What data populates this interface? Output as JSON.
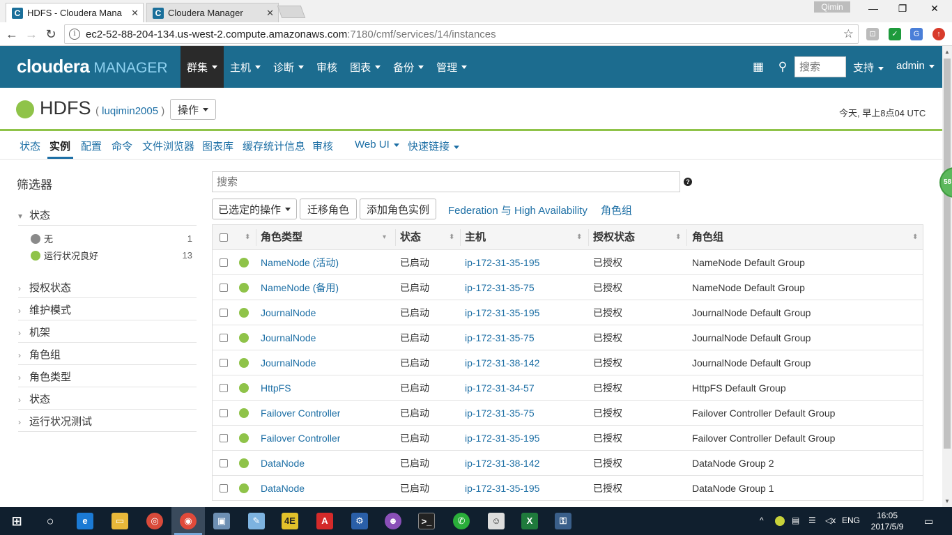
{
  "browser": {
    "tabs": [
      {
        "title": "HDFS - Cloudera Mana",
        "favicon": "C",
        "active": true
      },
      {
        "title": "Cloudera Manager",
        "favicon": "C",
        "active": false
      }
    ],
    "profile": "Qimin",
    "url_host": "ec2-52-88-204-134.us-west-2.compute.amazonaws.com",
    "url_path": ":7180/cmf/services/14/instances",
    "icons": [
      "back-icon",
      "forward-icon",
      "reload-icon",
      "star-icon"
    ]
  },
  "cm_header": {
    "logo_brand": "cloudera",
    "logo_product": "MANAGER",
    "nav": [
      "群集",
      "主机",
      "诊断",
      "审核",
      "图表",
      "备份",
      "管理"
    ],
    "nav_has_caret": [
      true,
      true,
      true,
      false,
      true,
      true,
      true
    ],
    "search_placeholder": "搜索",
    "support": "支持",
    "user": "admin"
  },
  "service": {
    "name": "HDFS",
    "cluster_prefix": "(",
    "cluster": "luqimin2005",
    "cluster_suffix": ")",
    "actions_label": "操作",
    "status_color": "#8fc349",
    "timestamp": "今天, 早上8点04 UTC"
  },
  "subtabs": [
    "状态",
    "实例",
    "配置",
    "命令",
    "文件浏览器",
    "图表库",
    "缓存统计信息",
    "审核",
    "Web UI",
    "快速链接"
  ],
  "subtabs_active": "实例",
  "filters": {
    "title": "筛选器",
    "status_section": "状态",
    "status_items": [
      {
        "label": "无",
        "count": "1",
        "color": "#8a8a8a"
      },
      {
        "label": "运行状况良好",
        "count": "13",
        "color": "#8fc349"
      }
    ],
    "sections": [
      "授权状态",
      "维护模式",
      "机架",
      "角色组",
      "角色类型",
      "状态",
      "运行状况测试"
    ]
  },
  "toolbar": {
    "search_placeholder": "搜索",
    "selected_actions": "已选定的操作",
    "migrate_roles": "迁移角色",
    "add_role_instances": "添加角色实例",
    "federation_link": "Federation 与 High Availability",
    "role_groups_link": "角色组",
    "help": "?"
  },
  "table": {
    "headers": [
      "角色类型",
      "状态",
      "主机",
      "授权状态",
      "角色组"
    ],
    "rows": [
      {
        "role": "NameNode (活动)",
        "state": "已启动",
        "host": "ip-172-31-35-195",
        "commission": "已授权",
        "group": "NameNode Default Group"
      },
      {
        "role": "NameNode (备用)",
        "state": "已启动",
        "host": "ip-172-31-35-75",
        "commission": "已授权",
        "group": "NameNode Default Group"
      },
      {
        "role": "JournalNode",
        "state": "已启动",
        "host": "ip-172-31-35-195",
        "commission": "已授权",
        "group": "JournalNode Default Group"
      },
      {
        "role": "JournalNode",
        "state": "已启动",
        "host": "ip-172-31-35-75",
        "commission": "已授权",
        "group": "JournalNode Default Group"
      },
      {
        "role": "JournalNode",
        "state": "已启动",
        "host": "ip-172-31-38-142",
        "commission": "已授权",
        "group": "JournalNode Default Group"
      },
      {
        "role": "HttpFS",
        "state": "已启动",
        "host": "ip-172-31-34-57",
        "commission": "已授权",
        "group": "HttpFS Default Group"
      },
      {
        "role": "Failover Controller",
        "state": "已启动",
        "host": "ip-172-31-35-75",
        "commission": "已授权",
        "group": "Failover Controller Default Group"
      },
      {
        "role": "Failover Controller",
        "state": "已启动",
        "host": "ip-172-31-35-195",
        "commission": "已授权",
        "group": "Failover Controller Default Group"
      },
      {
        "role": "DataNode",
        "state": "已启动",
        "host": "ip-172-31-38-142",
        "commission": "已授权",
        "group": "DataNode Group 2"
      },
      {
        "role": "DataNode",
        "state": "已启动",
        "host": "ip-172-31-35-195",
        "commission": "已授权",
        "group": "DataNode Group 1"
      }
    ]
  },
  "side_badge": "58",
  "taskbar": {
    "lang": "ENG",
    "time": "16:05",
    "date": "2017/5/9"
  }
}
